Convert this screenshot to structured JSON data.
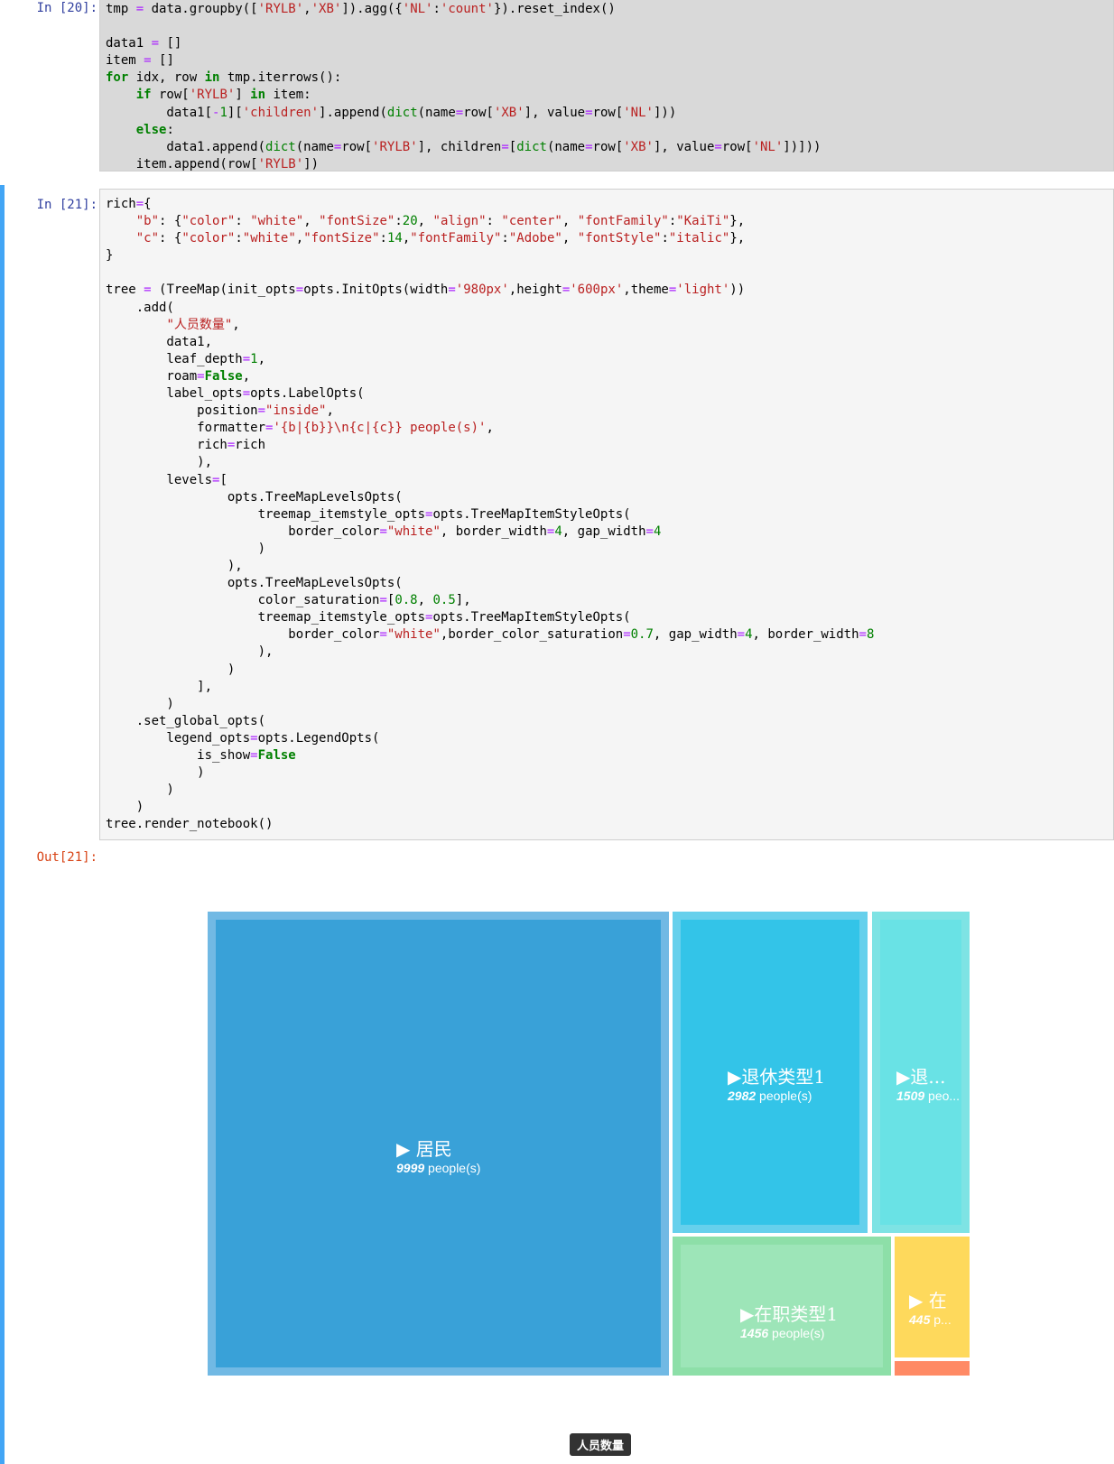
{
  "cell20": {
    "prompt": "In  [20]:",
    "lines": [
      "tmp = data.groupby(['RYLB','XB']).agg({'NL':'count'}).reset_index()",
      "",
      "data1 = []",
      "item = []",
      "for idx, row in tmp.iterrows():",
      "    if row['RYLB'] in item:",
      "        data1[-1]['children'].append(dict(name=row['XB'], value=row['NL']))",
      "    else:",
      "        data1.append(dict(name=row['RYLB'], children=[dict(name=row['XB'], value=row['NL'])]))",
      "    item.append(row['RYLB'])"
    ]
  },
  "cell21": {
    "prompt": "In  [21]:",
    "out_prompt": "Out[21]:",
    "lines": [
      "rich={",
      "    \"b\": {\"color\": \"white\", \"fontSize\":20, \"align\": \"center\", \"fontFamily\":\"KaiTi\"},",
      "    \"c\": {\"color\":\"white\",\"fontSize\":14,\"fontFamily\":\"Adobe\", \"fontStyle\":\"italic\"},",
      "}",
      "",
      "tree = (TreeMap(init_opts=opts.InitOpts(width='980px',height='600px',theme='light'))",
      "    .add(",
      "        \"人员数量\",",
      "        data1,",
      "        leaf_depth=1,",
      "        roam=False,",
      "        label_opts=opts.LabelOpts(",
      "            position=\"inside\",",
      "            formatter='{b|{b}}\\n{c|{c}} people(s)',",
      "            rich=rich",
      "            ),",
      "        levels=[",
      "                opts.TreeMapLevelsOpts(",
      "                    treemap_itemstyle_opts=opts.TreeMapItemStyleOpts(",
      "                        border_color=\"white\", border_width=4, gap_width=4",
      "                    )",
      "                ),",
      "                opts.TreeMapLevelsOpts(",
      "                    color_saturation=[0.8, 0.5],",
      "                    treemap_itemstyle_opts=opts.TreeMapItemStyleOpts(",
      "                        border_color=\"white\",border_color_saturation=0.7, gap_width=4, border_width=8",
      "                    ),",
      "                )",
      "            ],",
      "        )",
      "    .set_global_opts(",
      "        legend_opts=opts.LegendOpts(",
      "            is_show=False",
      "            )",
      "        )",
      "    )",
      "tree.render_notebook()"
    ]
  },
  "chart_data": {
    "type": "treemap",
    "series_name": "人员数量",
    "label_suffix": "people(s)",
    "nodes": [
      {
        "name": "居民",
        "label_name": "▶  居民",
        "value": 9999,
        "label_value": "9999",
        "color": "#39a1d8",
        "border": "#71b9e4"
      },
      {
        "name": "退休类型1",
        "label_name": "▶退休类型1",
        "value": 2982,
        "label_value": "2982",
        "color": "#33c4e8",
        "border": "#66d0ec"
      },
      {
        "name": "退...",
        "label_name": "▶退...",
        "value": 1509,
        "label_value": "1509",
        "value_suffix_shown": "peo...",
        "color": "#69e2e5",
        "border": "#7ee3e4"
      },
      {
        "name": "在职类型1",
        "label_name": "▶在职类型1",
        "value": 1456,
        "label_value": "1456",
        "color": "#9de5b8",
        "border": "#8ddfa8"
      },
      {
        "name": "在",
        "label_name": "▶ 在",
        "value": 445,
        "label_value": "445",
        "value_suffix_shown": "p...",
        "color": "#fed95c",
        "border": "#fed95c"
      },
      {
        "name": "",
        "label_name": "",
        "value": null,
        "label_value": "",
        "color": "#ff8a65",
        "border": "#ff8a65"
      }
    ]
  },
  "tooltip": "人员数量"
}
